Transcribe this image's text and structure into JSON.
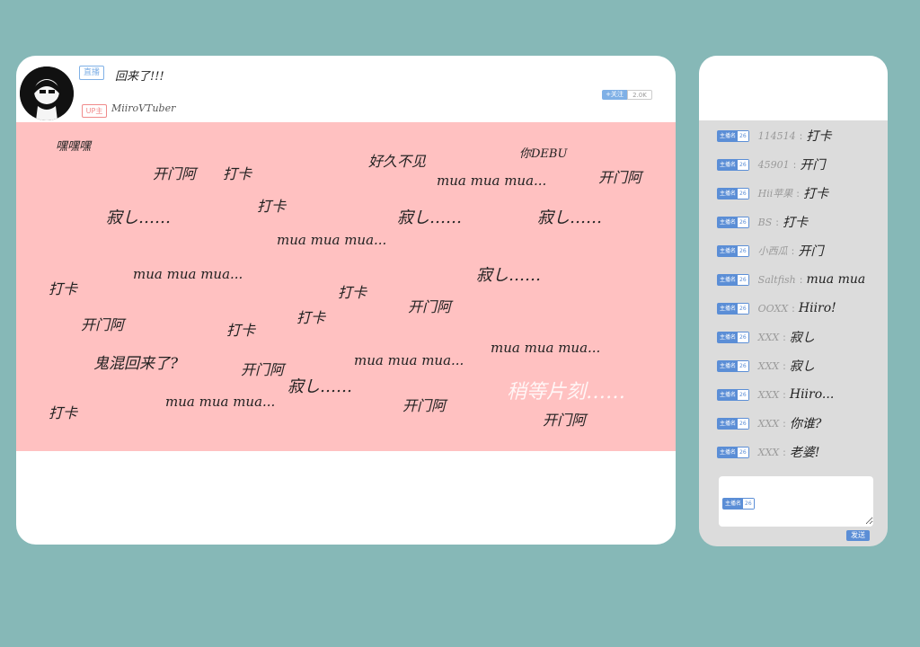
{
  "stream": {
    "live_badge": "直播",
    "title": "回来了!!!",
    "up_badge": "UP主",
    "streamer_name": "MiiroVTuber",
    "follow_label": "+关注",
    "follow_count": "2.0K",
    "overlay_text": "稍等片刻……",
    "danmaku": [
      "嘿嘿嘿",
      "开门阿",
      "打卡",
      "好久不见",
      "你DEBU",
      "mua mua mua...",
      "开门阿",
      "寂し……",
      "打卡",
      "寂し……",
      "寂し……",
      "mua mua mua...",
      "打卡",
      "mua mua mua...",
      "寂し……",
      "打卡",
      "开门阿",
      "打卡",
      "开门阿",
      "打卡",
      "鬼混回来了?",
      "开门阿",
      "mua mua mua...",
      "mua mua mua...",
      "寂し……",
      "打卡",
      "mua mua mua...",
      "开门阿",
      "开门阿"
    ]
  },
  "chat": {
    "medal": {
      "name": "主播名",
      "level": "26"
    },
    "messages": [
      {
        "user": "114514",
        "text": "打卡"
      },
      {
        "user": "45901",
        "text": "开门"
      },
      {
        "user": "Hii苹果",
        "text": "打卡"
      },
      {
        "user": "BS",
        "text": "打卡"
      },
      {
        "user": "小西瓜",
        "text": "开门"
      },
      {
        "user": "Saltfish",
        "text": "mua mua"
      },
      {
        "user": "OOXX",
        "text": "Hiiro!"
      },
      {
        "user": "XXX",
        "text": "寂し"
      },
      {
        "user": "XXX",
        "text": "寂し"
      },
      {
        "user": "XXX",
        "text": "Hiiro..."
      },
      {
        "user": "XXX",
        "text": "你谁?"
      },
      {
        "user": "XXX",
        "text": "老婆!"
      }
    ],
    "input_placeholder": "",
    "send_label": "发送"
  },
  "colors": {
    "background": "#86b8b7",
    "video": "#ffc1c1",
    "chat_bg": "#dcdcdc",
    "medal": "#5b8ed6"
  }
}
